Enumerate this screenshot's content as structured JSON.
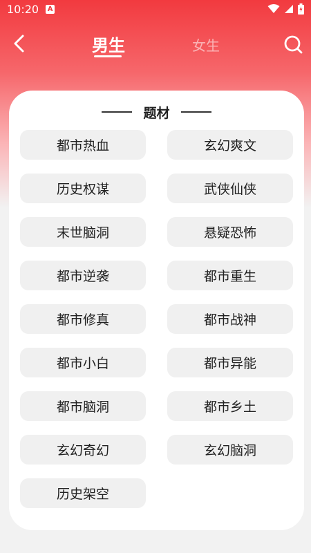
{
  "status_bar": {
    "time": "10:20",
    "a_badge": "A"
  },
  "nav": {
    "tabs": [
      {
        "label": "男生",
        "active": true
      },
      {
        "label": "女生",
        "active": false
      }
    ]
  },
  "card": {
    "title": "题材",
    "genres": [
      "都市热血",
      "玄幻爽文",
      "历史权谋",
      "武侠仙侠",
      "末世脑洞",
      "悬疑恐怖",
      "都市逆袭",
      "都市重生",
      "都市修真",
      "都市战神",
      "都市小白",
      "都市异能",
      "都市脑洞",
      "都市乡土",
      "玄幻奇幻",
      "玄幻脑洞",
      "历史架空"
    ]
  },
  "colors": {
    "accent": "#f23a3f",
    "chip_bg": "#f0f0f0"
  },
  "icons": [
    "back-arrow-icon",
    "search-icon",
    "wifi-icon",
    "cell-signal-icon",
    "battery-icon"
  ]
}
